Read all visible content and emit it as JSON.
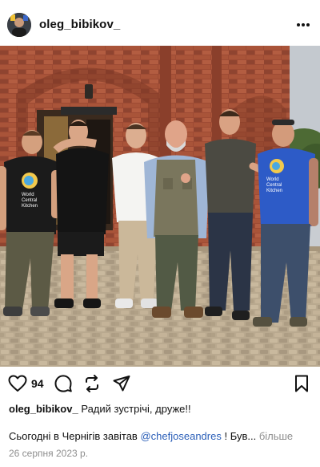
{
  "post": {
    "username": "oleg_bibikov_",
    "more_icon": "more-horizontal-icon",
    "likes": "94",
    "icons": {
      "like": "heart-icon",
      "comment": "comment-icon",
      "repost": "repost-icon",
      "share": "send-icon",
      "save": "bookmark-icon"
    },
    "caption": {
      "user": "oleg_bibikov_",
      "text": "Радий зустрічі, друже!!"
    },
    "body": {
      "text_before": "Сьогодні в Чернігів завітав",
      "mention": "@chefjoseandres",
      "text_after": "! Був...",
      "more_label": "більше"
    },
    "date": "26 серпня 2023 р."
  },
  "photo": {
    "shirt_text_line1": "World",
    "shirt_text_line2": "Central",
    "shirt_text_line3": "Kitchen",
    "shirt_text_right1": "World",
    "shirt_text_right2": "Central",
    "shirt_text_right3": "Kitchen"
  }
}
